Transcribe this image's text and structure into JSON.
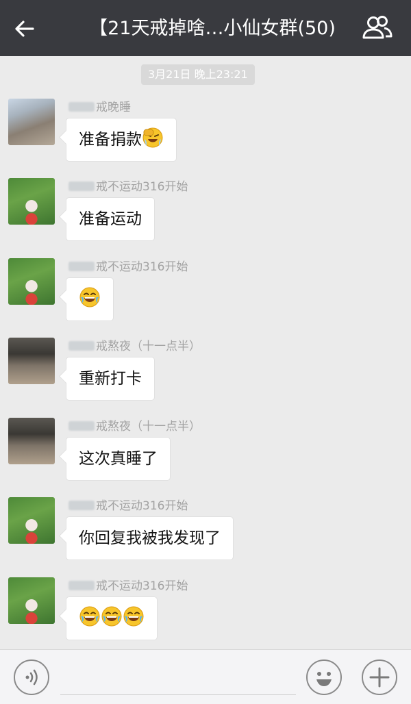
{
  "header": {
    "title": "【21天戒掉啥…小仙女群(50)",
    "back_icon": "arrow-left-icon",
    "members_icon": "group-members-icon",
    "background": "#393a3f"
  },
  "chat": {
    "timestamp": "3月21日 晚上23:21",
    "messages": [
      {
        "sender": "戒晚睡",
        "text": "准备捐款",
        "emoji": "😅"
      },
      {
        "sender": "戒不运动316开始",
        "text": "准备运动",
        "emoji": ""
      },
      {
        "sender": "戒不运动316开始",
        "text": "",
        "emoji": "😂"
      },
      {
        "sender": "戒熬夜（十一点半）",
        "text": "重新打卡",
        "emoji": ""
      },
      {
        "sender": "戒熬夜（十一点半）",
        "text": "这次真睡了",
        "emoji": ""
      },
      {
        "sender": "戒不运动316开始",
        "text": "你回复我被我发现了",
        "emoji": ""
      },
      {
        "sender": "戒不运动316开始",
        "text": "",
        "emoji": "😂😂😂"
      }
    ]
  },
  "inputbar": {
    "voice_icon": "voice-icon",
    "emoji_icon": "emoji-icon",
    "plus_icon": "plus-icon",
    "placeholder": ""
  }
}
